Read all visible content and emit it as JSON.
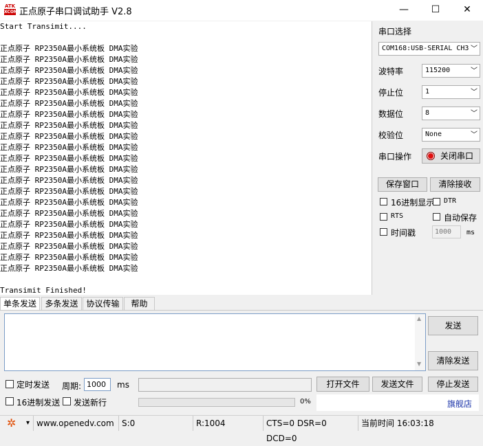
{
  "window": {
    "logo_top": "ATK",
    "logo_bottom": "XCOM",
    "title": "正点原子串口调试助手 V2.8",
    "minimize_glyph": "—",
    "maximize_glyph": "☐",
    "close_glyph": "✕"
  },
  "receive": {
    "lines": [
      "Start Transimit....",
      "",
      "正点原子 RP2350A最小系统板 DMA实验",
      "正点原子 RP2350A最小系统板 DMA实验",
      "正点原子 RP2350A最小系统板 DMA实验",
      "正点原子 RP2350A最小系统板 DMA实验",
      "正点原子 RP2350A最小系统板 DMA实验",
      "正点原子 RP2350A最小系统板 DMA实验",
      "正点原子 RP2350A最小系统板 DMA实验",
      "正点原子 RP2350A最小系统板 DMA实验",
      "正点原子 RP2350A最小系统板 DMA实验",
      "正点原子 RP2350A最小系统板 DMA实验",
      "正点原子 RP2350A最小系统板 DMA实验",
      "正点原子 RP2350A最小系统板 DMA实验",
      "正点原子 RP2350A最小系统板 DMA实验",
      "正点原子 RP2350A最小系统板 DMA实验",
      "正点原子 RP2350A最小系统板 DMA实验",
      "正点原子 RP2350A最小系统板 DMA实验",
      "正点原子 RP2350A最小系统板 DMA实验",
      "正点原子 RP2350A最小系统板 DMA实验",
      "正点原子 RP2350A最小系统板 DMA实验",
      "正点原子 RP2350A最小系统板 DMA实验",
      "正点原子 RP2350A最小系统板 DMA实验",
      "",
      "Transimit Finished!"
    ]
  },
  "serial": {
    "section_label": "串口选择",
    "port": "COM168:USB-SERIAL CH3",
    "baud_label": "波特率",
    "baud": "115200",
    "stop_label": "停止位",
    "stop": "1",
    "data_label": "数据位",
    "data": "8",
    "parity_label": "校验位",
    "parity": "None",
    "op_label": "串口操作",
    "close_port": "关闭串口",
    "save_window": "保存窗口",
    "clear_receive": "清除接收",
    "hex_display": "16进制显示",
    "dtr": "DTR",
    "rts": "RTS",
    "auto_save": "自动保存",
    "timestamp": "时间戳",
    "timestamp_value": "1000",
    "timestamp_unit": "ms",
    "arrow": "﹀"
  },
  "tabs": [
    "单条发送",
    "多条发送",
    "协议传输",
    "帮助"
  ],
  "send": {
    "send_button": "发送",
    "clear_send": "清除发送",
    "scroll_up": "▲",
    "scroll_down": "▼"
  },
  "bottom": {
    "timed_send": "定时发送",
    "period_label": "周期:",
    "period_value": "1000",
    "period_unit": "ms",
    "open_file": "打开文件",
    "send_file": "发送文件",
    "stop_send": "停止发送",
    "hex_send": "16进制发送",
    "send_newline": "发送新行",
    "progress": "0%",
    "flagship": "旗舰店"
  },
  "status": {
    "gear_glyph": "✲",
    "dropdown_glyph": "▾",
    "website": "www.openedv.com",
    "sent": "S:0",
    "received": "R:1004",
    "lines": "CTS=0 DSR=0 DCD=0",
    "time": "当前时间 16:03:18"
  },
  "colors": {
    "accent": "#7a9cc6",
    "led_red": "#e01010",
    "link_blue": "#1a33a8"
  }
}
